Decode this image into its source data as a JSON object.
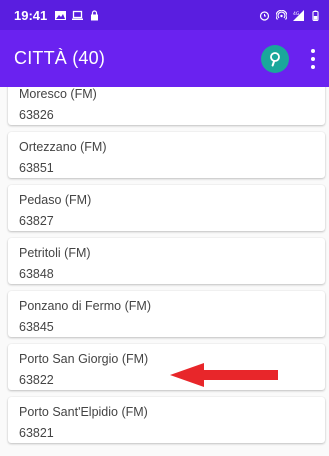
{
  "status_bar": {
    "time": "19:41",
    "left_icons": [
      "image-icon",
      "laptop-icon",
      "lock-icon"
    ],
    "right_icons": [
      "alarm-icon",
      "hotspot-icon",
      "signal-4g-icon",
      "battery-icon"
    ]
  },
  "app_bar": {
    "title": "CITTÀ (40)",
    "search_icon": "search-icon",
    "more_icon": "more-vert-icon",
    "colors": {
      "bar": "#6a22f0",
      "status": "#5a1ee0",
      "search_bg": "#1aa79b"
    }
  },
  "list": {
    "items": [
      {
        "name": "Moresco (FM)",
        "cap": "63826"
      },
      {
        "name": "Ortezzano (FM)",
        "cap": "63851"
      },
      {
        "name": "Pedaso (FM)",
        "cap": "63827"
      },
      {
        "name": "Petritoli (FM)",
        "cap": "63848"
      },
      {
        "name": "Ponzano di Fermo (FM)",
        "cap": "63845"
      },
      {
        "name": "Porto San Giorgio (FM)",
        "cap": "63822"
      },
      {
        "name": "Porto Sant'Elpidio (FM)",
        "cap": "63821"
      }
    ]
  },
  "annotation": {
    "arrow_color": "#e8262a"
  }
}
